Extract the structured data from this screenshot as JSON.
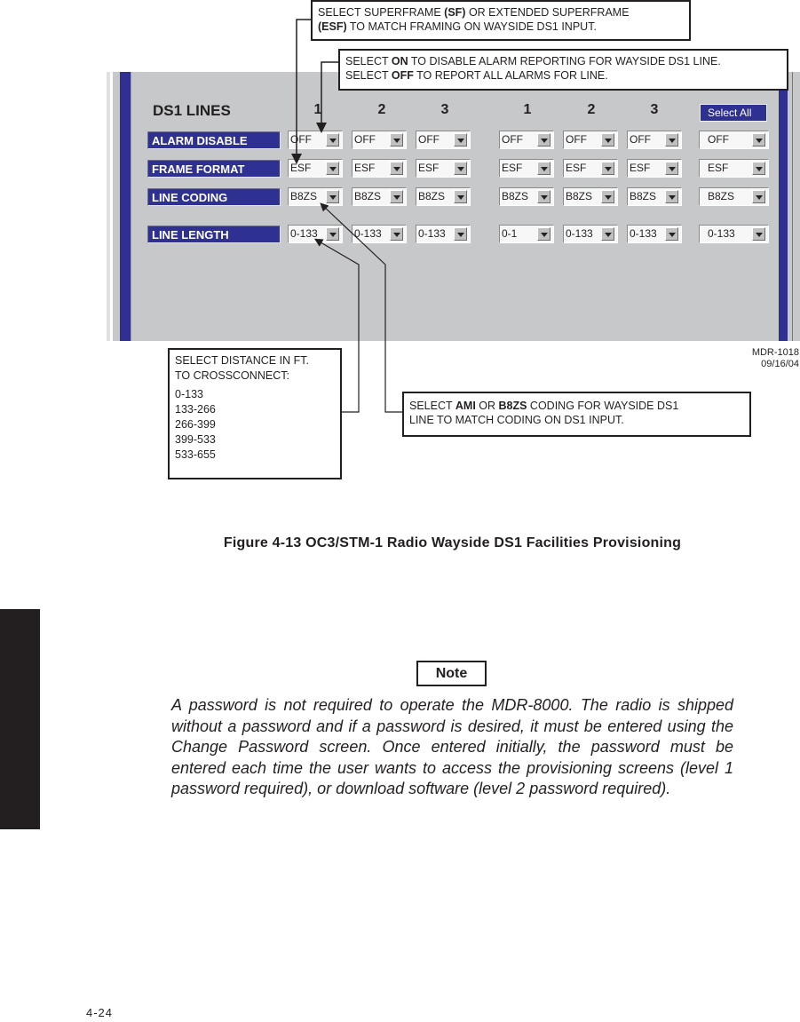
{
  "screen": {
    "title": "DS1 LINES",
    "group_a_columns": [
      "1",
      "2",
      "3"
    ],
    "group_b_columns": [
      "1",
      "2",
      "3"
    ],
    "select_all_label": "Select All",
    "rows": [
      {
        "label": "ALARM DISABLE",
        "values": [
          "OFF",
          "OFF",
          "OFF",
          "OFF",
          "OFF",
          "OFF"
        ],
        "select_all_value": "OFF"
      },
      {
        "label": "FRAME FORMAT",
        "values": [
          "ESF",
          "ESF",
          "ESF",
          "ESF",
          "ESF",
          "ESF"
        ],
        "select_all_value": "ESF"
      },
      {
        "label": "LINE CODING",
        "values": [
          "B8ZS",
          "B8ZS",
          "B8ZS",
          "B8ZS",
          "B8ZS",
          "B8ZS"
        ],
        "select_all_value": "B8ZS"
      },
      {
        "label": "LINE LENGTH",
        "values": [
          "0-133",
          "0-133",
          "0-133",
          "0-1",
          "0-133",
          "0-133"
        ],
        "select_all_value": "0-133"
      }
    ]
  },
  "callouts": {
    "frame_format": {
      "line1_pre": "SELECT SUPERFRAME ",
      "line1_b1": "(SF)",
      "line1_post": " OR EXTENDED SUPERFRAME",
      "line2_b": "(ESF)",
      "line2_post": " TO MATCH FRAMING ON WAYSIDE DS1 INPUT."
    },
    "alarm_disable": {
      "line1_pre": "SELECT ",
      "line1_b": "ON",
      "line1_post": " TO DISABLE ALARM REPORTING FOR WAYSIDE DS1 LINE.",
      "line2_pre": "SELECT ",
      "line2_b": "OFF",
      "line2_post": " TO REPORT ALL ALARMS FOR LINE."
    },
    "line_length": {
      "line1": "SELECT DISTANCE IN FT.",
      "line2": "TO CROSSCONNECT:",
      "options": [
        "0-133",
        "133-266",
        "266-399",
        "399-533",
        "533-655"
      ]
    },
    "line_coding": {
      "line1_pre": "SELECT ",
      "line1_b1": "AMI",
      "line1_mid": " OR ",
      "line1_b2": "B8ZS",
      "line1_post": " CODING FOR WAYSIDE DS1",
      "line2": "LINE TO MATCH CODING ON DS1 INPUT."
    }
  },
  "figure_id": {
    "code": "MDR-1018",
    "date": "09/16/04"
  },
  "figure_caption": "Figure 4-13  OC3/STM-1 Radio Wayside DS1 Facilities Provisioning",
  "note": {
    "heading": "Note",
    "text": "A password is not required to operate the MDR-8000. The radio is shipped without a password and if a password is desired, it must be entered using the Change Password screen. Once entered initially, the password must be entered each time the user wants to access the provisioning screens (level 1 password required), or download software (level 2 password required)."
  },
  "page_number": "4-24",
  "colors": {
    "panel_blue": "#2e3192",
    "panel_gray": "#c7c8ca",
    "text_dark": "#231f20"
  }
}
